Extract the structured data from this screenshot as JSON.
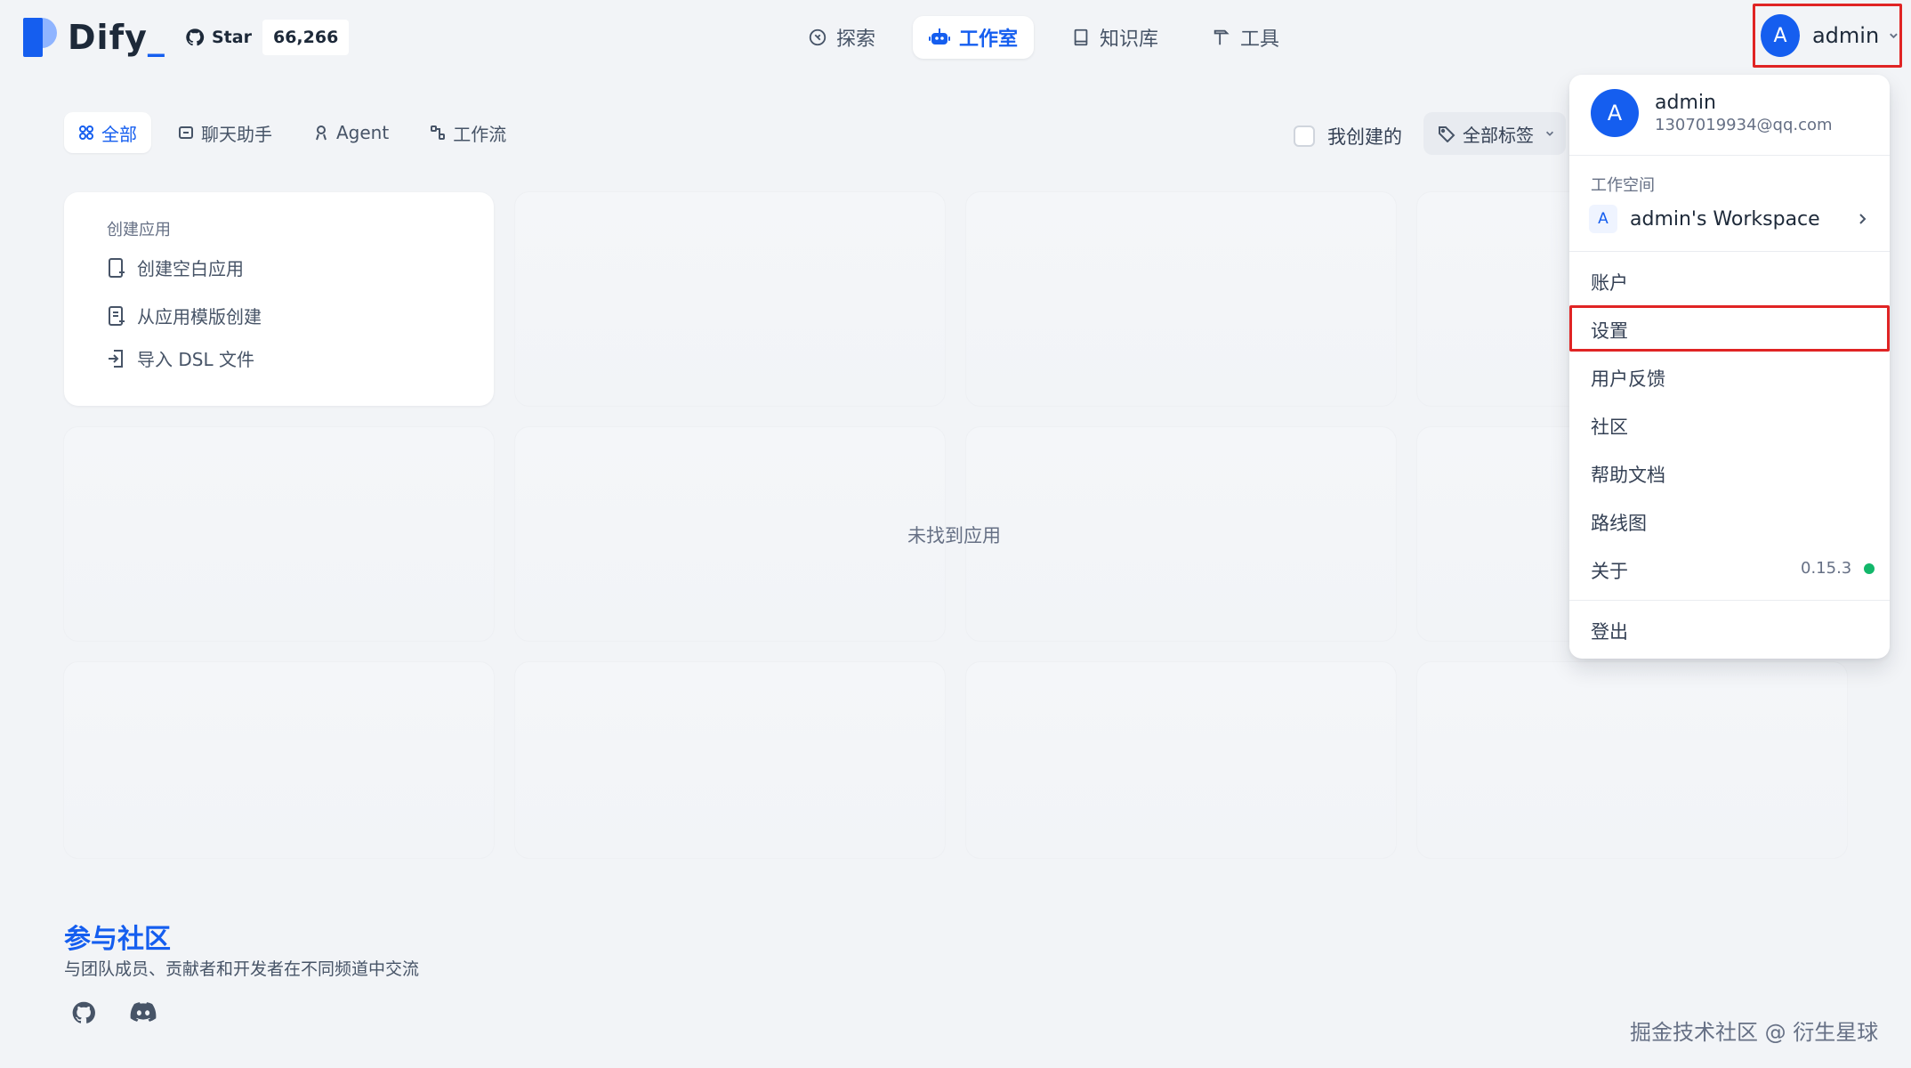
{
  "header": {
    "logo_text": "Dify",
    "github": {
      "star_label": "Star",
      "count": "66,266"
    },
    "nav": [
      {
        "label": "探索",
        "icon": "compass-icon"
      },
      {
        "label": "工作室",
        "icon": "robot-icon",
        "active": true
      },
      {
        "label": "知识库",
        "icon": "book-icon"
      },
      {
        "label": "工具",
        "icon": "hammer-icon"
      }
    ],
    "user": {
      "avatar_letter": "A",
      "name": "admin"
    }
  },
  "tabs": [
    {
      "label": "全部",
      "active": true
    },
    {
      "label": "聊天助手"
    },
    {
      "label": "Agent"
    },
    {
      "label": "工作流"
    }
  ],
  "filters": {
    "mine_label": "我创建的",
    "tag_label": "全部标签"
  },
  "create_card": {
    "title": "创建应用",
    "items": [
      "创建空白应用",
      "从应用模版创建",
      "导入 DSL 文件"
    ]
  },
  "empty_text": "未找到应用",
  "footer": {
    "title": "参与社区",
    "subtitle": "与团队成员、贡献者和开发者在不同频道中交流"
  },
  "watermark": "掘金技术社区 @ 衍生星球",
  "dropdown": {
    "avatar_letter": "A",
    "name": "admin",
    "email": "1307019934@qq.com",
    "workspace_label": "工作空间",
    "workspace_badge": "A",
    "workspace_name": "admin's Workspace",
    "items": [
      "账户",
      "设置",
      "用户反馈",
      "社区",
      "帮助文档",
      "路线图",
      "关于"
    ],
    "version": "0.15.3",
    "logout": "登出"
  },
  "colors": {
    "accent": "#155eef",
    "highlight": "#e02424",
    "status_ok": "#12b76a"
  }
}
